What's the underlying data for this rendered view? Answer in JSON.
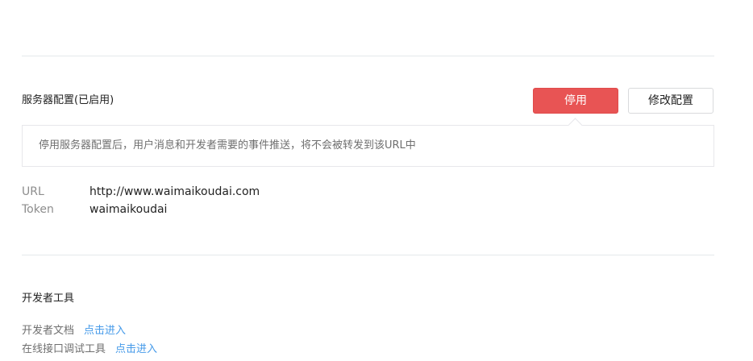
{
  "server_config": {
    "title": "服务器配置(已启用)",
    "disable_button": "停用",
    "modify_button": "修改配置",
    "tip": "停用服务器配置后，用户消息和开发者需要的事件推送，将不会被转发到该URL中",
    "fields": [
      {
        "label": "URL",
        "value": "http://www.waimaikoudai.com"
      },
      {
        "label": "Token",
        "value": "waimaikoudai"
      }
    ]
  },
  "developer_tools": {
    "title": "开发者工具",
    "items": [
      {
        "label": "开发者文档",
        "link": "点击进入"
      },
      {
        "label": "在线接口调试工具",
        "link": "点击进入"
      }
    ]
  },
  "colors": {
    "danger": "#e85454",
    "link": "#459ae9",
    "divider": "#e4e8eb"
  }
}
